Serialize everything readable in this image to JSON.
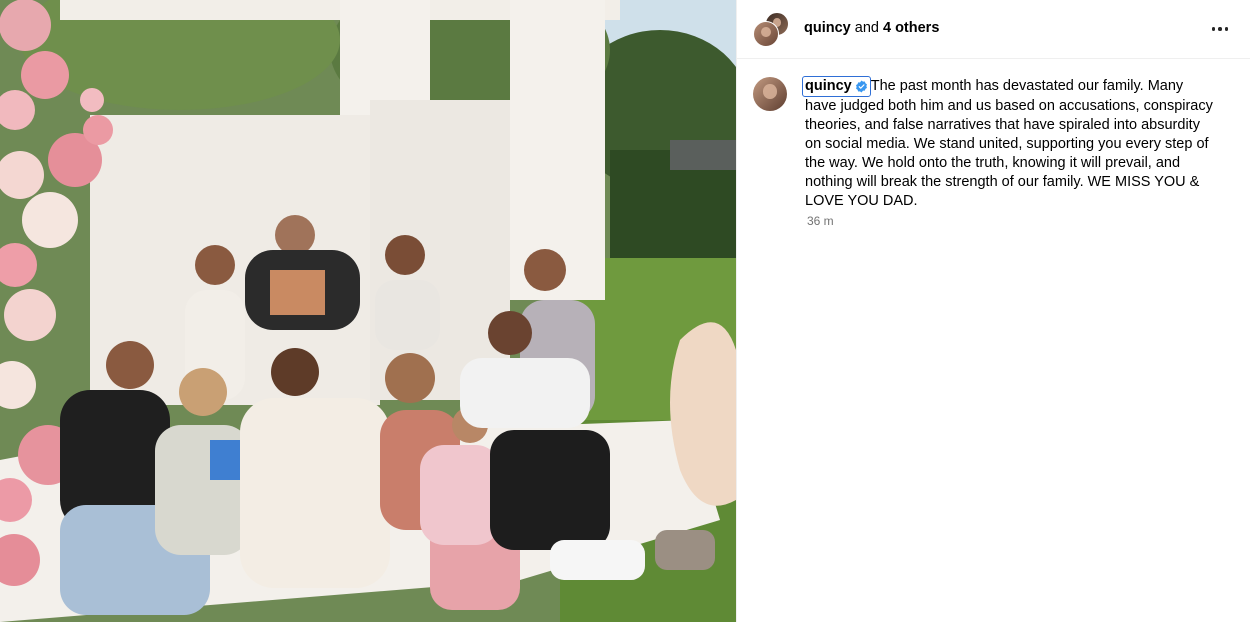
{
  "header": {
    "owner_username": "quincy",
    "owner_suffix": " and ",
    "owner_others": "4 others",
    "more_icon": "more-horizontal-icon"
  },
  "post": {
    "username": "quincy",
    "verified_icon": "verified-badge-icon",
    "caption": "The past month has devastated our family. Many have judged both him and us based on accusations, conspiracy theories, and false narratives that have spiraled into absurdity on social media. We stand united, supporting you every step of the way. We hold onto the truth, knowing it will prevail, and nothing will break the strength of our family. WE MISS YOU & LOVE YOU DAD.",
    "timestamp": "36 m"
  },
  "colors": {
    "verified_blue": "#3897f0",
    "focus_outline": "#2f6fd6",
    "muted_text": "#737373"
  }
}
